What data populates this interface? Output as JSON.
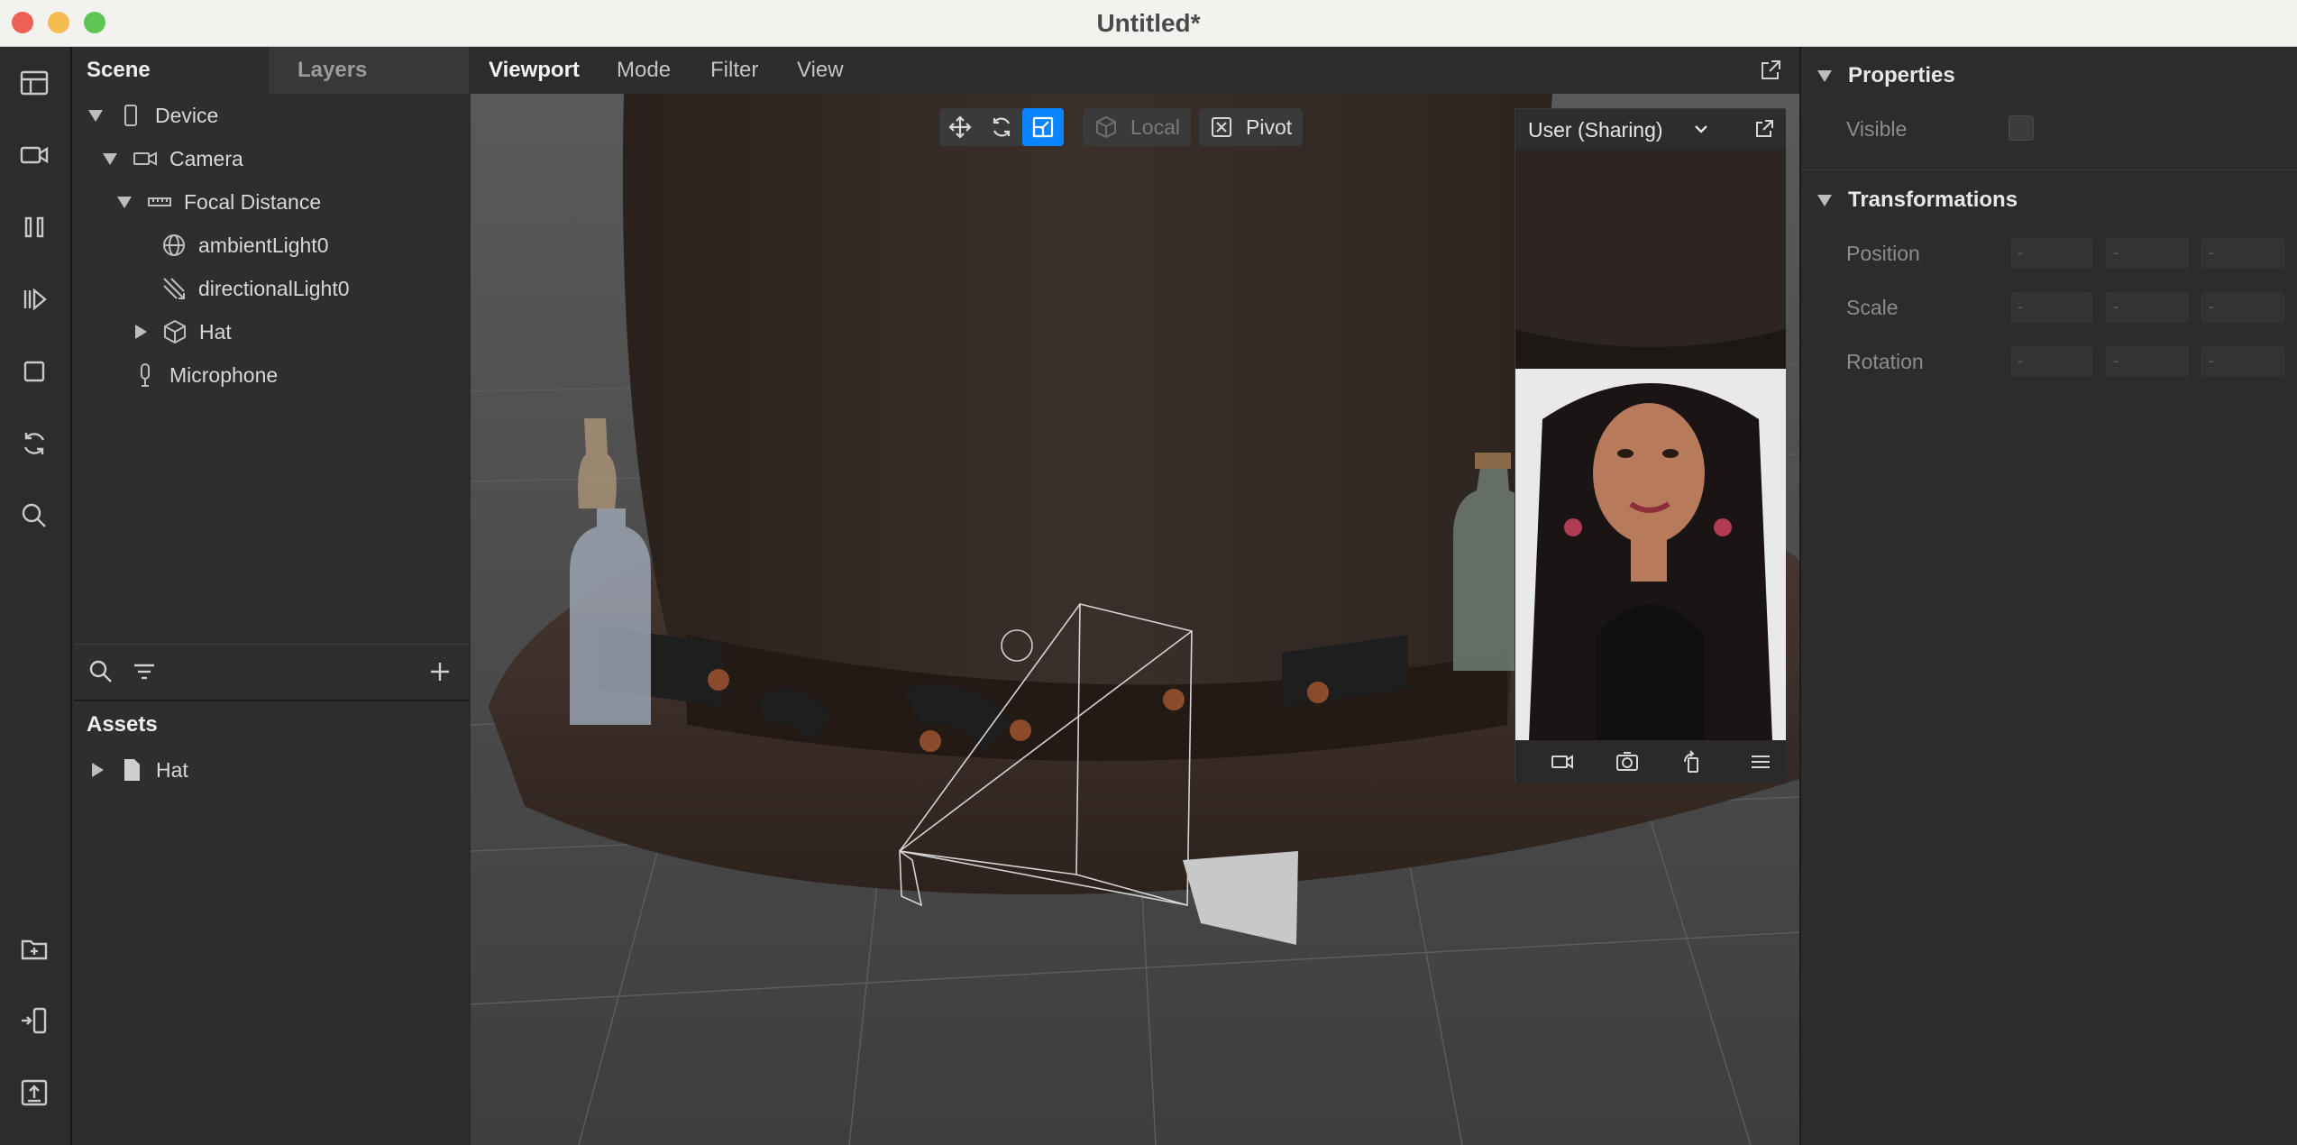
{
  "window": {
    "title": "Untitled*"
  },
  "scene_panel": {
    "tabs": [
      "Scene",
      "Layers"
    ],
    "tree": [
      {
        "label": "Device",
        "icon": "phone-icon"
      },
      {
        "label": "Camera",
        "icon": "camera-icon"
      },
      {
        "label": "Focal Distance",
        "icon": "ruler-icon"
      },
      {
        "label": "ambientLight0",
        "icon": "globe-light-icon"
      },
      {
        "label": "directionalLight0",
        "icon": "directional-light-icon"
      },
      {
        "label": "Hat",
        "icon": "cube-icon"
      },
      {
        "label": "Microphone",
        "icon": "microphone-icon"
      }
    ]
  },
  "assets_panel": {
    "title": "Assets",
    "items": [
      {
        "label": "Hat",
        "icon": "file-icon"
      }
    ]
  },
  "viewport": {
    "menus": [
      "Viewport",
      "Mode",
      "Filter",
      "View"
    ],
    "local_label": "Local",
    "pivot_label": "Pivot",
    "accent_color": "#0a84ff"
  },
  "simulator": {
    "title": "User (Sharing)"
  },
  "properties": {
    "title": "Properties",
    "visible_label": "Visible",
    "transform_title": "Transformations",
    "rows": [
      "Position",
      "Scale",
      "Rotation"
    ],
    "placeholder": "-"
  }
}
